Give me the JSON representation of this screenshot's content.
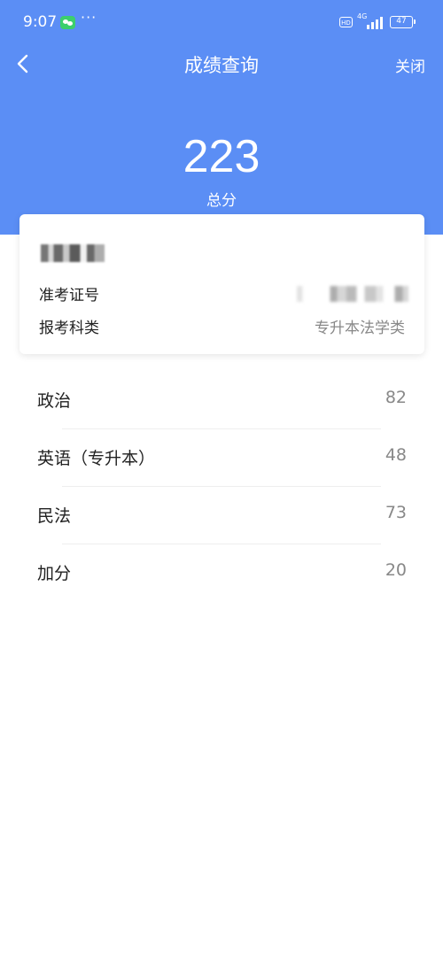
{
  "status_bar": {
    "time": "9:07",
    "more": "···",
    "hd": "HD",
    "network": "4G",
    "battery": "47"
  },
  "nav": {
    "title": "成绩查询",
    "close_label": "关闭"
  },
  "summary": {
    "total_score": "223",
    "total_label": "总分"
  },
  "card": {
    "exam_id_label": "准考证号",
    "category_label": "报考科类",
    "category_value": "专升本法学类"
  },
  "scores": [
    {
      "subject": "政治",
      "score": "82"
    },
    {
      "subject": "英语（专升本）",
      "score": "48"
    },
    {
      "subject": "民法",
      "score": "73"
    },
    {
      "subject": "加分",
      "score": "20"
    }
  ],
  "colors": {
    "header_bg": "#5b8ef5",
    "value_text": "#888888"
  }
}
